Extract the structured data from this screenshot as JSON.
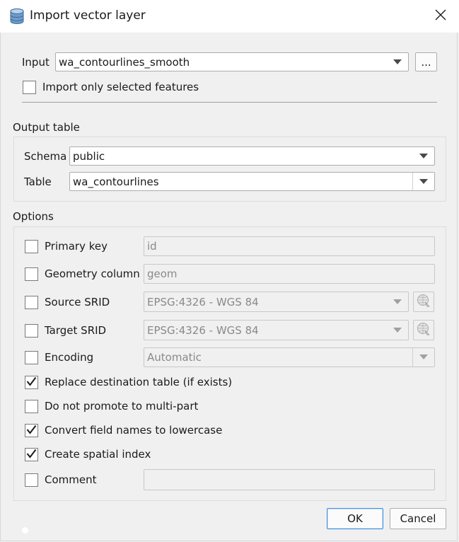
{
  "window": {
    "title": "Import vector layer",
    "icon": "database-icon",
    "close_icon": "close-icon"
  },
  "input": {
    "label": "Input",
    "value": "wa_contourlines_smooth",
    "browse_label": "...",
    "only_selected_label": "Import only selected features",
    "only_selected_checked": false
  },
  "output_table": {
    "group_label": "Output table",
    "schema_label": "Schema",
    "schema_value": "public",
    "table_label": "Table",
    "table_value": "wa_contourlines"
  },
  "options": {
    "group_label": "Options",
    "primary_key": {
      "label": "Primary key",
      "checked": false,
      "value": "id"
    },
    "geometry_column": {
      "label": "Geometry column",
      "checked": false,
      "value": "geom"
    },
    "source_srid": {
      "label": "Source SRID",
      "checked": false,
      "value": "EPSG:4326 - WGS 84"
    },
    "target_srid": {
      "label": "Target SRID",
      "checked": false,
      "value": "EPSG:4326 - WGS 84"
    },
    "encoding": {
      "label": "Encoding",
      "checked": false,
      "value": "Automatic"
    },
    "replace_table": {
      "label": "Replace destination table (if exists)",
      "checked": true
    },
    "no_multipart": {
      "label": "Do not promote to multi-part",
      "checked": false
    },
    "lowercase": {
      "label": "Convert field names to lowercase",
      "checked": true
    },
    "spatial_index": {
      "label": "Create spatial index",
      "checked": true
    },
    "comment": {
      "label": "Comment",
      "checked": false,
      "value": ""
    }
  },
  "buttons": {
    "ok": "OK",
    "cancel": "Cancel"
  }
}
